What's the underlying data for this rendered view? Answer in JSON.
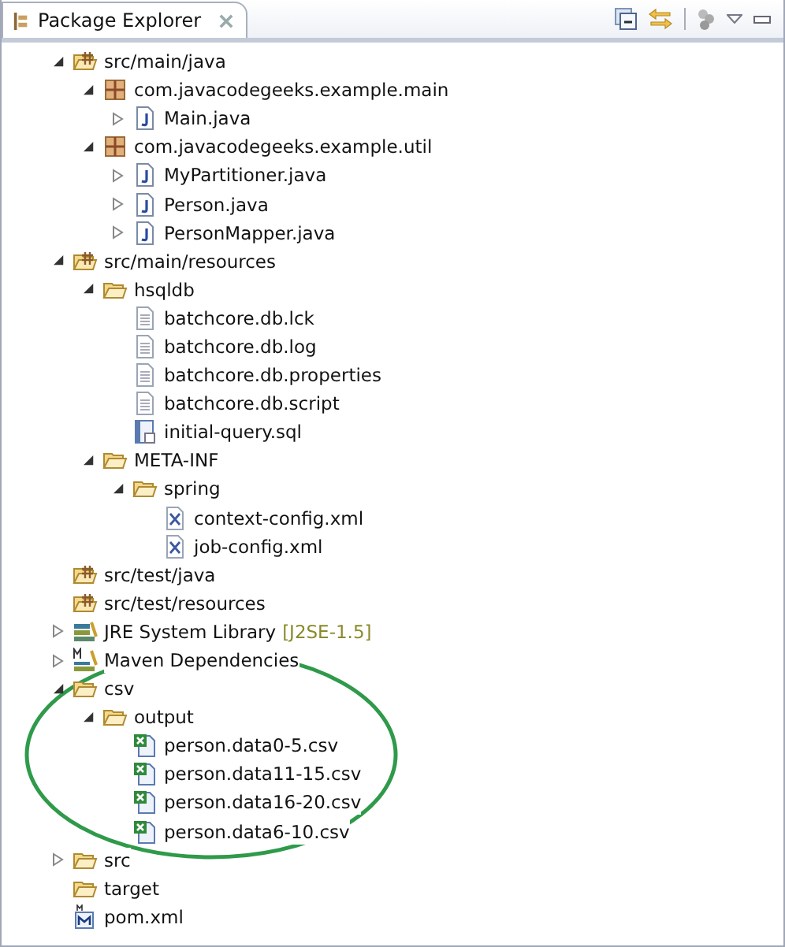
{
  "view": {
    "title": "Package Explorer"
  },
  "tree": [
    {
      "label": "src/main/java",
      "kind": "source-folder",
      "expanded": true,
      "children": [
        {
          "label": "com.javacodegeeks.example.main",
          "kind": "package",
          "expanded": true,
          "children": [
            {
              "label": "Main.java",
              "kind": "java",
              "expanded": false
            }
          ]
        },
        {
          "label": "com.javacodegeeks.example.util",
          "kind": "package",
          "expanded": true,
          "children": [
            {
              "label": "MyPartitioner.java",
              "kind": "java",
              "expanded": false
            },
            {
              "label": "Person.java",
              "kind": "java",
              "expanded": false
            },
            {
              "label": "PersonMapper.java",
              "kind": "java",
              "expanded": false
            }
          ]
        }
      ]
    },
    {
      "label": "src/main/resources",
      "kind": "source-folder",
      "expanded": true,
      "children": [
        {
          "label": "hsqldb",
          "kind": "folder",
          "expanded": true,
          "children": [
            {
              "label": "batchcore.db.lck",
              "kind": "file"
            },
            {
              "label": "batchcore.db.log",
              "kind": "file"
            },
            {
              "label": "batchcore.db.properties",
              "kind": "file"
            },
            {
              "label": "batchcore.db.script",
              "kind": "file"
            },
            {
              "label": "initial-query.sql",
              "kind": "sql"
            }
          ]
        },
        {
          "label": "META-INF",
          "kind": "folder",
          "expanded": true,
          "children": [
            {
              "label": "spring",
              "kind": "folder",
              "expanded": true,
              "children": [
                {
                  "label": "context-config.xml",
                  "kind": "xml"
                },
                {
                  "label": "job-config.xml",
                  "kind": "xml"
                }
              ]
            }
          ]
        }
      ]
    },
    {
      "label": "src/test/java",
      "kind": "source-folder"
    },
    {
      "label": "src/test/resources",
      "kind": "source-folder"
    },
    {
      "label": "JRE System Library",
      "decoration": "[J2SE-1.5]",
      "kind": "library",
      "expanded": false
    },
    {
      "label": "Maven Dependencies",
      "kind": "maven",
      "expanded": false
    },
    {
      "label": "csv",
      "kind": "folder",
      "expanded": true,
      "children": [
        {
          "label": "output",
          "kind": "folder",
          "expanded": true,
          "children": [
            {
              "label": "person.data0-5.csv",
              "kind": "csv"
            },
            {
              "label": "person.data11-15.csv",
              "kind": "csv"
            },
            {
              "label": "person.data16-20.csv",
              "kind": "csv"
            },
            {
              "label": "person.data6-10.csv",
              "kind": "csv"
            }
          ]
        }
      ]
    },
    {
      "label": "src",
      "kind": "folder",
      "expanded": false
    },
    {
      "label": "target",
      "kind": "folder"
    },
    {
      "label": "pom.xml",
      "kind": "pom"
    }
  ]
}
